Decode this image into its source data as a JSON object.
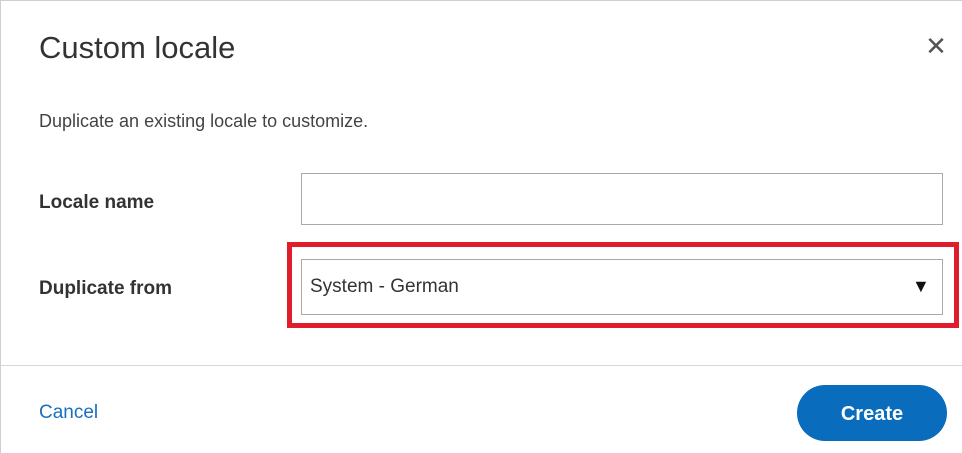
{
  "dialog": {
    "title": "Custom locale",
    "close_icon": "close-icon",
    "close_glyph": "✕",
    "subtitle": "Duplicate an existing locale to customize."
  },
  "form": {
    "locale_name": {
      "label": "Locale name",
      "value": "",
      "placeholder": ""
    },
    "duplicate_from": {
      "label": "Duplicate from",
      "selected": "System - German",
      "arrow_icon": "triangle-down-icon",
      "arrow_glyph": "▼"
    }
  },
  "footer": {
    "cancel_label": "Cancel",
    "create_label": "Create"
  },
  "colors": {
    "accent": "#0a6cbd",
    "link": "#1a6fc0",
    "highlight": "#e01e2b"
  }
}
